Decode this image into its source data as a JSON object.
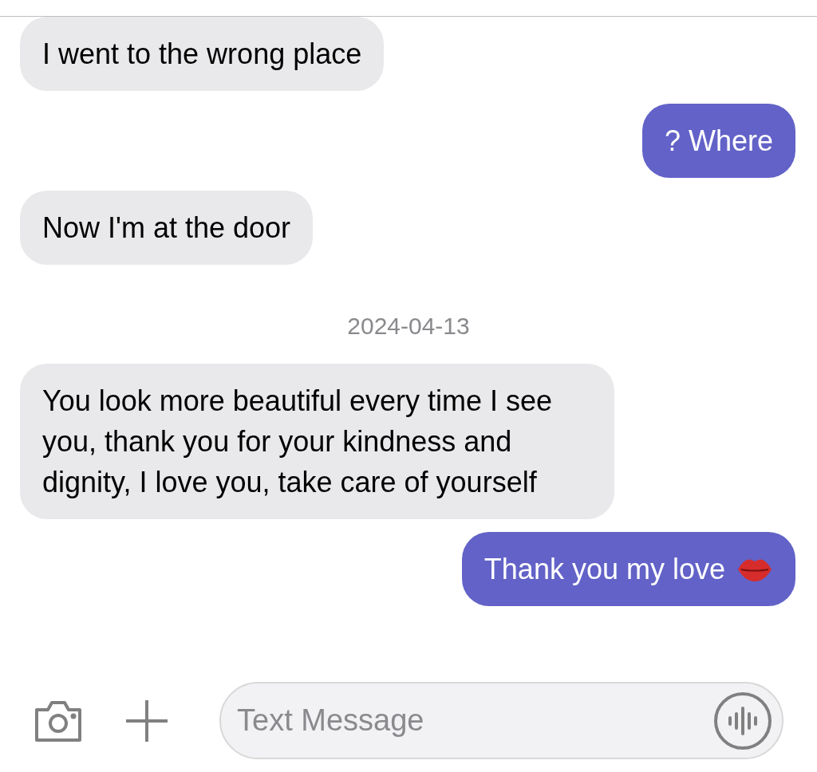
{
  "messages": [
    {
      "kind": "incoming",
      "text": "I went to the wrong place"
    },
    {
      "kind": "outgoing",
      "text": "? Where"
    },
    {
      "kind": "incoming",
      "text": "Now I'm at the door"
    },
    {
      "kind": "date",
      "text": "2024-04-13"
    },
    {
      "kind": "incoming",
      "text": "You look more beautiful every time I see you, thank you for your kindness and dignity, I love you, take care of yourself"
    },
    {
      "kind": "outgoing",
      "text": "Thank you my love",
      "kiss_emoji": true
    }
  ],
  "composer": {
    "placeholder": "Text Message"
  }
}
